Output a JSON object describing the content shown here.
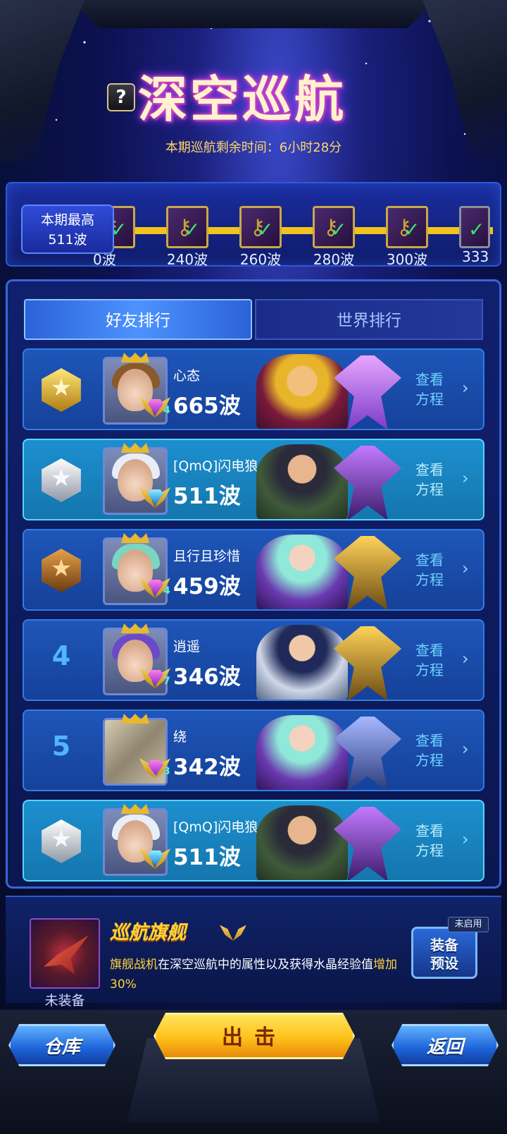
{
  "header": {
    "help_label": "?",
    "title": "深空巡航",
    "remaining": "本期巡航剩余时间：6小时28分"
  },
  "progress": {
    "best_label": "本期最高",
    "best_value": "511波",
    "milestones": [
      {
        "label": "0波"
      },
      {
        "label": "240波"
      },
      {
        "label": "260波"
      },
      {
        "label": "280波"
      },
      {
        "label": "300波"
      },
      {
        "label": "333"
      }
    ]
  },
  "tabs": {
    "friends": "好友排行",
    "world": "世界排行"
  },
  "ranking": [
    {
      "rank": "1",
      "name": "心态",
      "waves": "665波",
      "vip": "4",
      "view": "查看",
      "view2": "方程"
    },
    {
      "rank": "",
      "name": "[QmQ]闪电狼",
      "waves": "511波",
      "vip": "",
      "view": "查看",
      "view2": "方程"
    },
    {
      "rank": "3",
      "name": "且行且珍惜",
      "waves": "459波",
      "vip": "4",
      "view": "查看",
      "view2": "方程"
    },
    {
      "rank": "4",
      "name": "逍遥",
      "waves": "346波",
      "vip": "7",
      "view": "查看",
      "view2": "方程"
    },
    {
      "rank": "5",
      "name": "绕",
      "waves": "342波",
      "vip": "3",
      "view": "查看",
      "view2": "方程"
    },
    {
      "rank": "",
      "name": "[QmQ]闪电狼",
      "waves": "511波",
      "vip": "",
      "view": "查看",
      "view2": "方程"
    }
  ],
  "flagship": {
    "title": "巡航旗舰",
    "desc_hl1": "旗舰战机",
    "desc_mid": "在深空巡航中的属性以及获得水晶经验值",
    "desc_hl2": "增加30%",
    "unequipped": "未装备",
    "preset_line1": "装备",
    "preset_line2": "预设",
    "preset_tag": "未启用"
  },
  "buttons": {
    "warehouse": "仓库",
    "attack": "出击",
    "back": "返回"
  }
}
